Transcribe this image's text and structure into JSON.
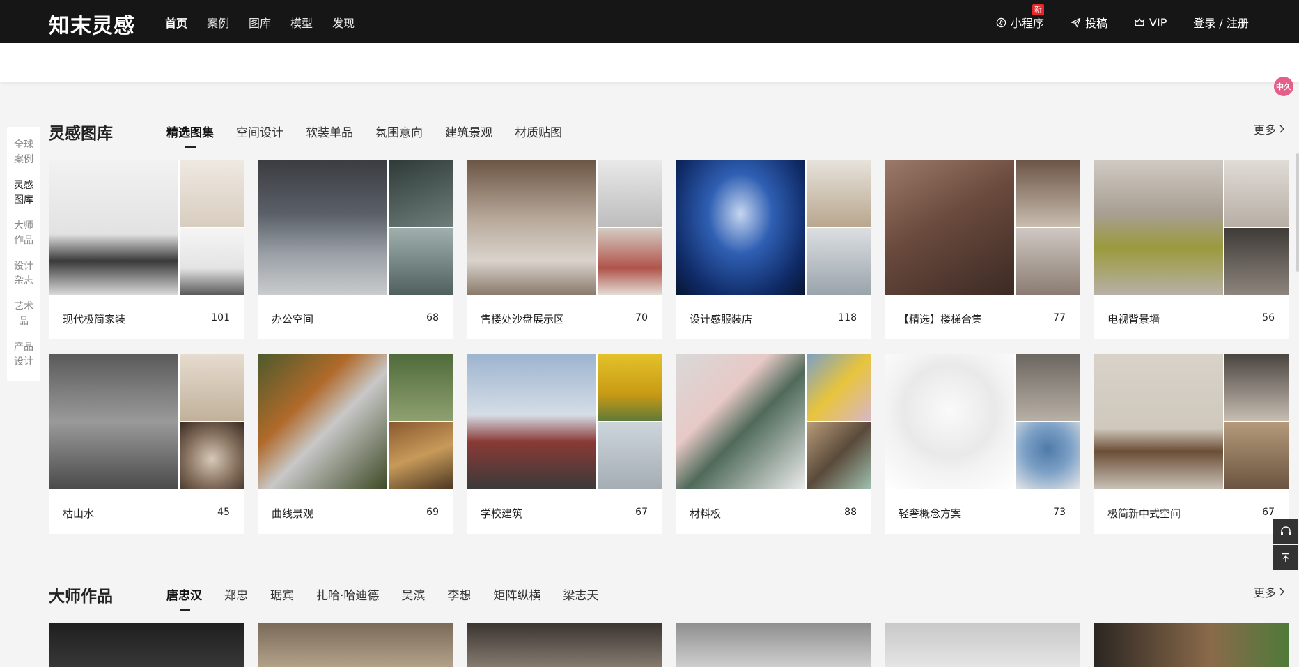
{
  "header": {
    "logo": "知末灵感",
    "nav": [
      "首页",
      "案例",
      "图库",
      "模型",
      "发现"
    ],
    "miniapp": "小程序",
    "miniapp_badge": "新",
    "submit": "投稿",
    "vip": "VIP",
    "login": "登录 / 注册"
  },
  "floating_avatar": "中久",
  "sidenav": [
    {
      "label": "全球案例",
      "active": false
    },
    {
      "label": "灵感图库",
      "active": true
    },
    {
      "label": "大师作品",
      "active": false
    },
    {
      "label": "设计杂志",
      "active": false
    },
    {
      "label": "艺术品",
      "active": false
    },
    {
      "label": "产品设计",
      "active": false
    }
  ],
  "gallery": {
    "title": "灵感图库",
    "tabs": [
      "精选图集",
      "空间设计",
      "软装单品",
      "氛围意向",
      "建筑景观",
      "材质贴图"
    ],
    "more": "更多",
    "cards": [
      {
        "label": "现代极简家装",
        "count": "101"
      },
      {
        "label": "办公空间",
        "count": "68"
      },
      {
        "label": "售楼处沙盘展示区",
        "count": "70"
      },
      {
        "label": "设计感服装店",
        "count": "118"
      },
      {
        "label": "【精选】楼梯合集",
        "count": "77"
      },
      {
        "label": "电视背景墙",
        "count": "56"
      },
      {
        "label": "枯山水",
        "count": "45"
      },
      {
        "label": "曲线景观",
        "count": "69"
      },
      {
        "label": "学校建筑",
        "count": "67"
      },
      {
        "label": "材料板",
        "count": "88"
      },
      {
        "label": "轻奢概念方案",
        "count": "73"
      },
      {
        "label": "极简新中式空间",
        "count": "67"
      }
    ]
  },
  "masters": {
    "title": "大师作品",
    "tabs": [
      "唐忠汉",
      "郑忠",
      "琚宾",
      "扎哈·哈迪德",
      "吴滨",
      "李想",
      "矩阵纵横",
      "梁志天"
    ],
    "more": "更多"
  },
  "colors": {
    "header_bg": "#161616",
    "page_bg": "#f4f4f4",
    "badge": "#e8262b"
  }
}
